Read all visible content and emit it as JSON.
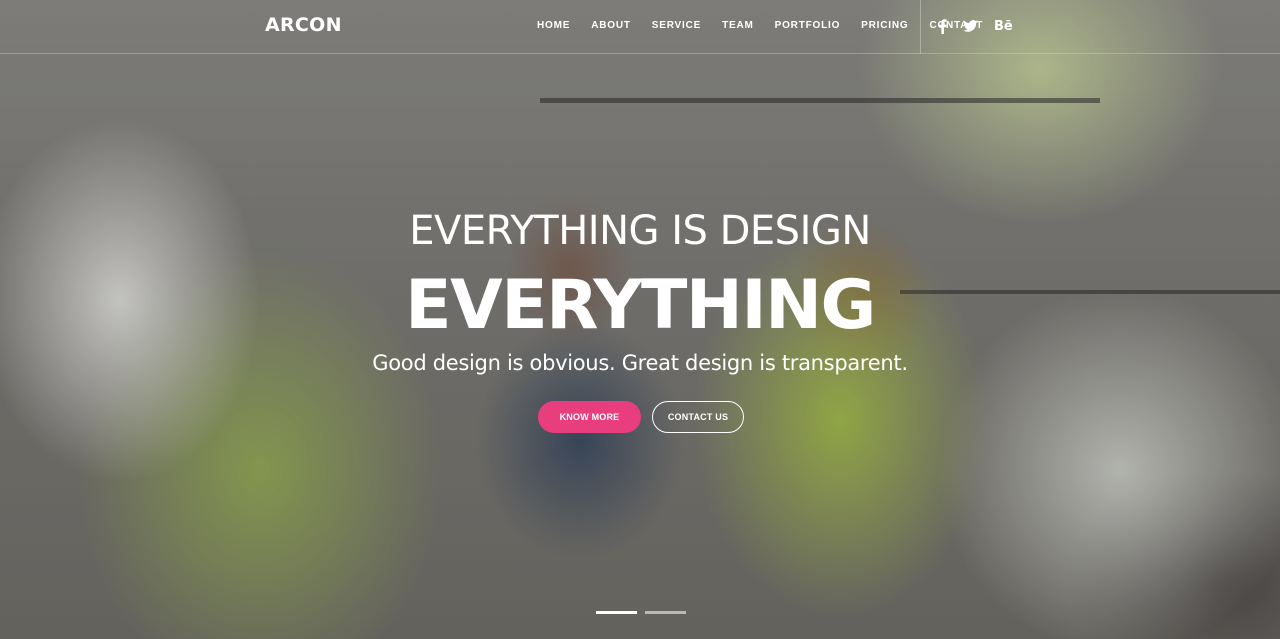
{
  "brand": {
    "logo": "ARCON"
  },
  "nav": {
    "items": [
      {
        "label": "HOME"
      },
      {
        "label": "ABOUT"
      },
      {
        "label": "SERVICE"
      },
      {
        "label": "TEAM"
      },
      {
        "label": "PORTFOLIO"
      },
      {
        "label": "PRICING"
      },
      {
        "label": "CONTACT"
      }
    ]
  },
  "social": {
    "icons": [
      "facebook-icon",
      "twitter-icon",
      "behance-icon"
    ],
    "behance_label": "Bē"
  },
  "hero": {
    "eyebrow": "EVERYTHING IS DESIGN",
    "headline": "EVERYTHING",
    "tagline": "Good design is obvious. Great design is transparent.",
    "primary_button": "KNOW MORE",
    "secondary_button": "CONTACT US",
    "slides": {
      "count": 2,
      "active": 1
    }
  },
  "colors": {
    "accent": "#e83e7e",
    "text": "#ffffff"
  }
}
